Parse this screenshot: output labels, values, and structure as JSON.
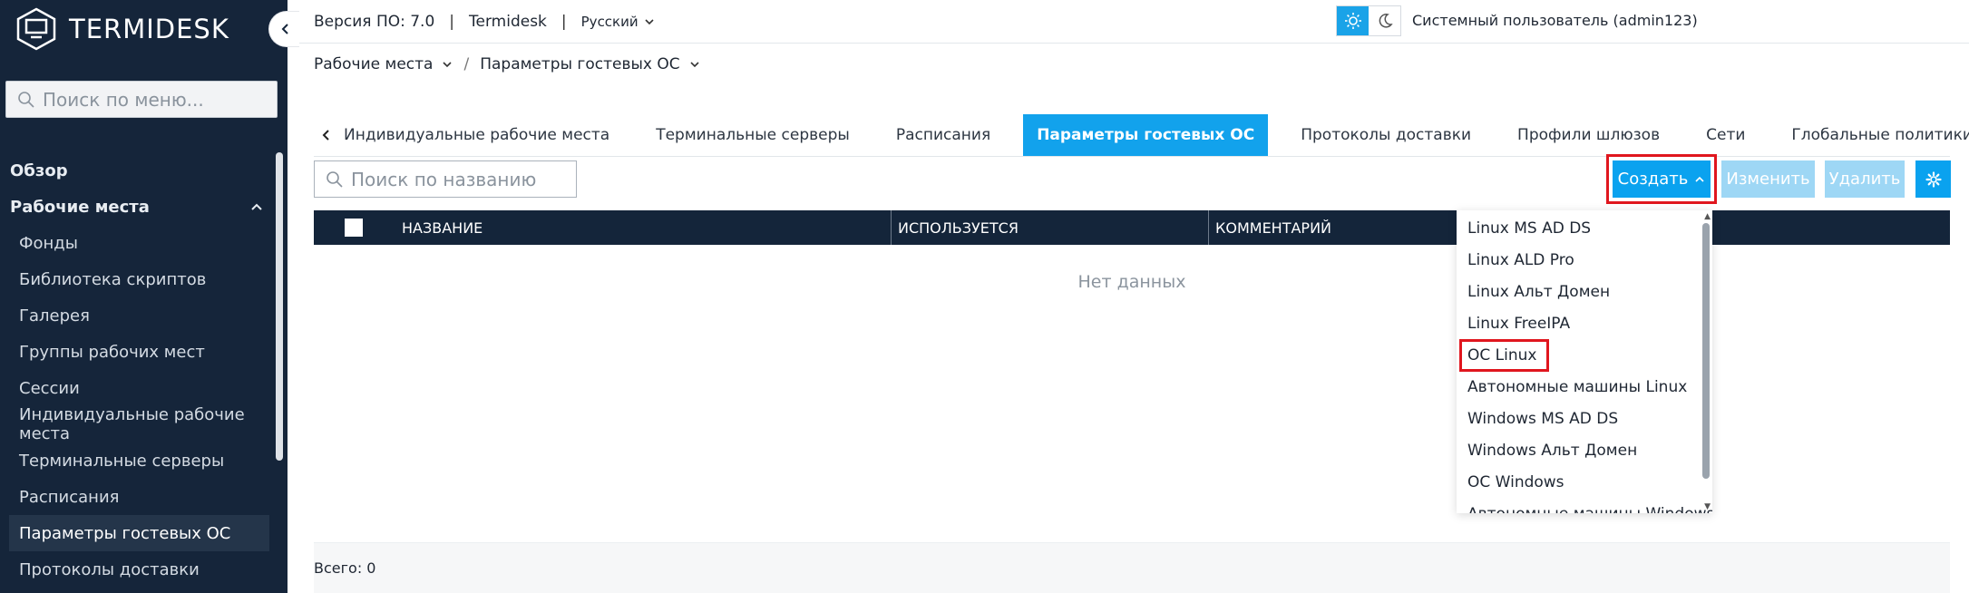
{
  "app": {
    "brand": "TERMIDESK"
  },
  "topbar": {
    "version": "Версия ПО: 7.0",
    "product": "Termidesk",
    "language": "Русский",
    "user": "Системный пользователь (admin123)"
  },
  "sidebar": {
    "search_placeholder": "Поиск по меню...",
    "overview": "Обзор",
    "section": "Рабочие места",
    "items": [
      {
        "label": "Фонды"
      },
      {
        "label": "Библиотека скриптов"
      },
      {
        "label": "Галерея"
      },
      {
        "label": "Группы рабочих мест"
      },
      {
        "label": "Сессии"
      },
      {
        "label": "Индивидуальные рабочие места"
      },
      {
        "label": "Терминальные серверы"
      },
      {
        "label": "Расписания"
      },
      {
        "label": "Параметры гостевых ОС"
      },
      {
        "label": "Протоколы доставки"
      }
    ]
  },
  "breadcrumb": {
    "parent": "Рабочие места",
    "current": "Параметры гостевых ОС"
  },
  "tabs": [
    {
      "label": "Индивидуальные рабочие места"
    },
    {
      "label": "Терминальные серверы"
    },
    {
      "label": "Расписания"
    },
    {
      "label": "Параметры гостевых ОС"
    },
    {
      "label": "Протоколы доставки"
    },
    {
      "label": "Профили шлюзов"
    },
    {
      "label": "Сети"
    },
    {
      "label": "Глобальные политики"
    }
  ],
  "toolbar": {
    "search_placeholder": "Поиск по названию",
    "create_label": "Создать",
    "edit_label": "Изменить",
    "delete_label": "Удалить"
  },
  "table": {
    "columns": [
      "НАЗВАНИЕ",
      "ИСПОЛЬЗУЕТСЯ",
      "КОММЕНТАРИЙ"
    ],
    "empty_text": "Нет данных",
    "total": "Всего: 0"
  },
  "create_menu": {
    "items": [
      {
        "label": "Linux MS AD DS"
      },
      {
        "label": "Linux ALD Pro"
      },
      {
        "label": "Linux Альт Домен"
      },
      {
        "label": "Linux FreeIPA"
      },
      {
        "label": "ОС Linux"
      },
      {
        "label": "Автономные машины Linux"
      },
      {
        "label": "Windows MS AD DS"
      },
      {
        "label": "Windows Альт Домен"
      },
      {
        "label": "ОС Windows"
      },
      {
        "label": "Автономные машины Windows"
      }
    ]
  },
  "colors": {
    "sidebar_bg": "#15253a",
    "accent": "#0aa2ef",
    "highlight_outline": "#e0161e",
    "disabled_button": "#9ed7f5"
  }
}
